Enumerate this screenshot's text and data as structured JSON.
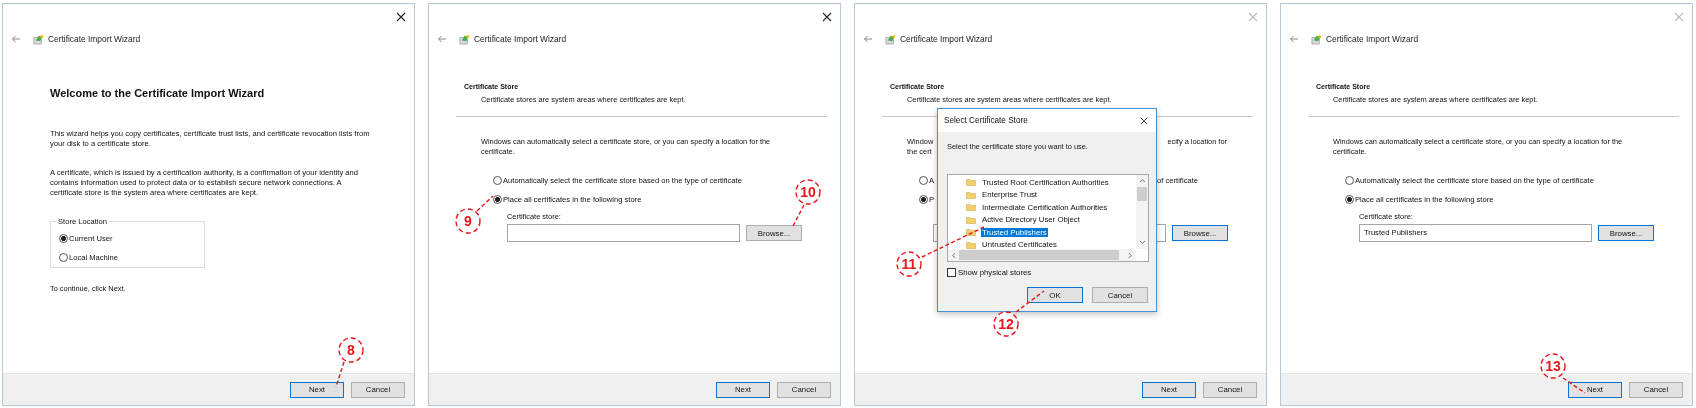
{
  "panels": [
    {
      "kind": "welcome",
      "title": "Certificate Import Wizard",
      "close_disabled": false,
      "heading": "Welcome to the Certificate Import Wizard",
      "paragraphs": [
        "This wizard helps you copy certificates, certificate trust lists, and certificate revocation lists from your disk to a certificate store.",
        "A certificate, which is issued by a certification authority, is a confirmation of your identity and contains information used to protect data or to establish secure network connections. A certificate store is the system area where certificates are kept."
      ],
      "store_location": {
        "legend": "Store Location",
        "options": [
          {
            "label": "Current User",
            "selected": true
          },
          {
            "label": "Local Machine",
            "selected": false
          }
        ]
      },
      "hint": "To continue, click Next.",
      "buttons": [
        {
          "label": "Next",
          "default": true
        },
        {
          "label": "Cancel",
          "default": false
        }
      ],
      "callouts": [
        {
          "label": "8"
        }
      ]
    },
    {
      "kind": "store",
      "title": "Certificate Import Wizard",
      "close_disabled": false,
      "heading": "Certificate Store",
      "subheading": "Certificate stores are system areas where certificates are kept.",
      "intro": "Windows can automatically select a certificate store, or you can specify a location for the certificate.",
      "options": [
        {
          "label": "Automatically select the certificate store based on the type of certificate",
          "selected": false
        },
        {
          "label": "Place all certificates in the following store",
          "selected": true
        }
      ],
      "store_label": "Certificate store:",
      "browse": {
        "label": "Browse...",
        "focused": false
      },
      "buttons": [
        {
          "label": "Next",
          "default": true
        },
        {
          "label": "Cancel",
          "default": false
        }
      ],
      "callouts": [
        {
          "label": "9"
        },
        {
          "label": "10"
        }
      ]
    },
    {
      "kind": "store_covered",
      "title": "Certificate Import Wizard",
      "close_disabled": true,
      "heading": "Certificate Store",
      "subheading": "Certificate stores are system areas where certificates are kept.",
      "intro_lines": [
        {
          "left": "Window",
          "right": "ecify a location for"
        },
        {
          "left": "the cert"
        }
      ],
      "options": [
        {
          "left": "A",
          "right": "of certificate",
          "selected": false
        },
        {
          "left": "P",
          "selected": true
        }
      ],
      "browse": {
        "label": "Browse...",
        "focused": true
      },
      "buttons": [
        {
          "label": "Next",
          "default": true
        },
        {
          "label": "Cancel",
          "default": false
        }
      ],
      "dialog": {
        "title": "Select Certificate Store",
        "prompt": "Select the certificate store you want to use.",
        "stores": [
          {
            "label": "Trusted Root Certification Authorities",
            "selected": false
          },
          {
            "label": "Enterprise Trust",
            "selected": false
          },
          {
            "label": "Intermediate Certification Authorities",
            "selected": false
          },
          {
            "label": "Active Directory User Object",
            "selected": false
          },
          {
            "label": "Trusted Publishers",
            "selected": true
          },
          {
            "label": "Untrusted Certificates",
            "selected": false
          }
        ],
        "show_physical": {
          "label": "Show physical stores",
          "checked": false
        },
        "buttons": [
          {
            "label": "OK",
            "default": true
          },
          {
            "label": "Cancel",
            "default": false
          }
        ]
      },
      "callouts": [
        {
          "label": "11"
        },
        {
          "label": "12"
        }
      ]
    },
    {
      "kind": "store",
      "title": "Certificate Import Wizard",
      "close_disabled": true,
      "heading": "Certificate Store",
      "subheading": "Certificate stores are system areas where certificates are kept.",
      "intro": "Windows can automatically select a certificate store, or you can specify a location for the certificate.",
      "options": [
        {
          "label": "Automatically select the certificate store based on the type of certificate",
          "selected": false
        },
        {
          "label": "Place all certificates in the following store",
          "selected": true
        }
      ],
      "store_label": "Certificate store:",
      "store_value": "Trusted Publishers",
      "browse": {
        "label": "Browse...",
        "focused": true
      },
      "buttons": [
        {
          "label": "Next",
          "default": true
        },
        {
          "label": "Cancel",
          "default": false
        }
      ],
      "callouts": [
        {
          "label": "13"
        }
      ]
    }
  ]
}
